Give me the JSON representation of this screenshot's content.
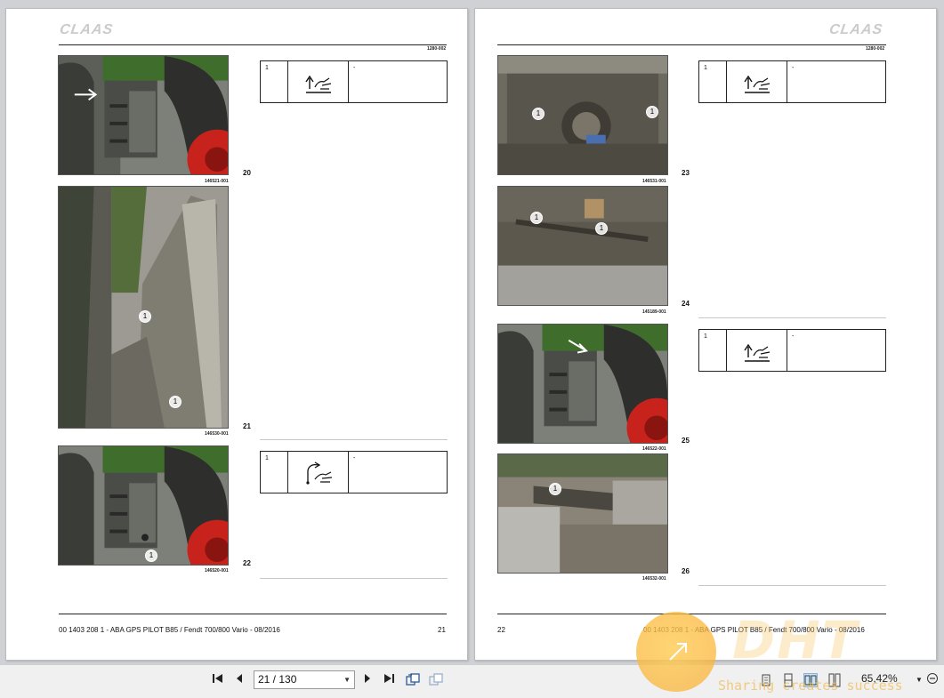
{
  "left_page": {
    "logo": "CLAAS",
    "doc_number": "1280-002",
    "figures": [
      {
        "number": "20",
        "photo_code": "146521-001"
      },
      {
        "number": "21",
        "photo_code": "146530-001"
      },
      {
        "number": "22",
        "photo_code": "146520-001"
      }
    ],
    "steps": [
      {
        "number": "1",
        "icon": "lift-hand-icon",
        "text": "-"
      },
      {
        "number": "1",
        "icon": "swing-hand-icon",
        "text": "-"
      }
    ],
    "callout": "1",
    "footer_left": "00 1403 208 1 - ABA GPS PILOT B85 / Fendt 700/800 Vario - 08/2016",
    "footer_page": "21"
  },
  "right_page": {
    "logo": "CLAAS",
    "doc_number": "1280-002",
    "figures": [
      {
        "number": "23",
        "photo_code": "146531-001"
      },
      {
        "number": "24",
        "photo_code": "145189-001"
      },
      {
        "number": "25",
        "photo_code": "146522-001"
      },
      {
        "number": "26",
        "photo_code": "146532-001"
      }
    ],
    "steps": [
      {
        "number": "1",
        "icon": "lift-hand-icon",
        "text": "-"
      },
      {
        "number": "1",
        "icon": "lift-hand-icon",
        "text": "-"
      }
    ],
    "callout": "1",
    "footer_left": "22",
    "footer_right": "00 1403 208 1 - ABA GPS PILOT B85 / Fendt 700/800 Vario - 08/2016"
  },
  "toolbar": {
    "first_page_icon": "first-page-icon",
    "prev_page_icon": "prev-page-icon",
    "page_value": "21 / 130",
    "next_page_icon": "next-page-icon",
    "last_page_icon": "last-page-icon",
    "zoom_value": "65,42%"
  },
  "watermark": {
    "brand": "DHT",
    "tagline": "Sharing creates success"
  },
  "colors": {
    "background": "#cfd1d4",
    "page": "#ffffff",
    "tractor_green": "#3f6e2c",
    "wheel_red": "#c8221c"
  }
}
